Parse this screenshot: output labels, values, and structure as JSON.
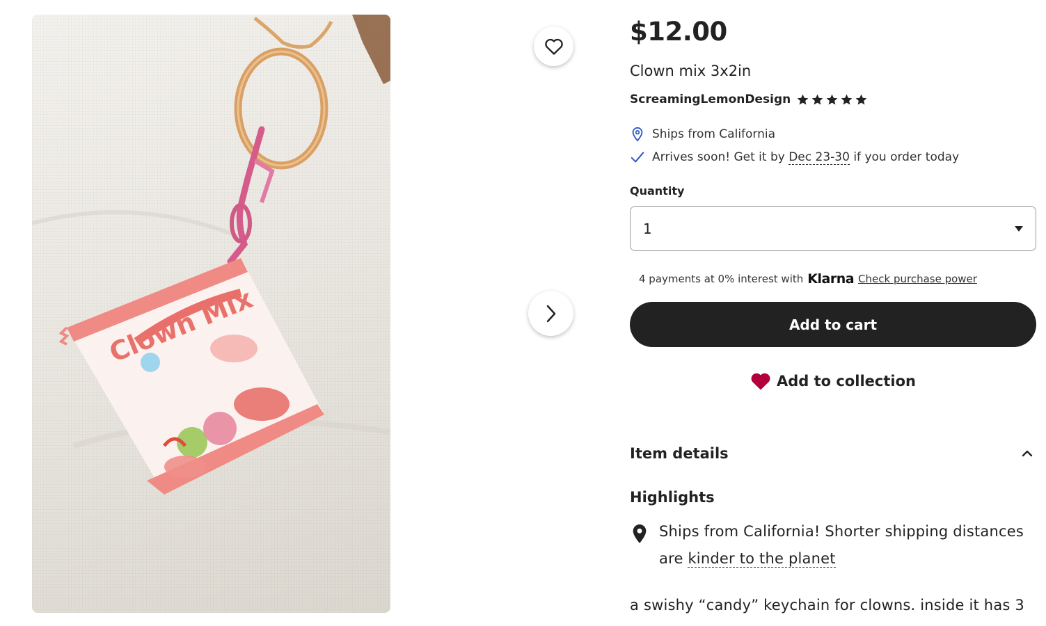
{
  "product": {
    "price": "$12.00",
    "title": "Clown mix 3x2in",
    "seller": "ScreamingLemonDesign",
    "rating_stars": 5,
    "image_text": "Clown Mix"
  },
  "shipping": {
    "ships_from": "Ships from California",
    "arrive_prefix": "Arrives soon! Get it by ",
    "arrive_dates": "Dec 23-30",
    "arrive_suffix": " if you order today"
  },
  "quantity": {
    "label": "Quantity",
    "selected": "1"
  },
  "klarna": {
    "text": "4 payments at 0% interest with",
    "logo": "Klarna",
    "link": "Check purchase power"
  },
  "actions": {
    "add_to_cart": "Add to cart",
    "add_to_collection": "Add to collection"
  },
  "details": {
    "title": "Item details",
    "highlights_title": "Highlights",
    "highlight_text_1": "Ships from California! Shorter shipping distances",
    "highlight_text_2_prefix": "are ",
    "highlight_link": "kinder to the planet",
    "description": "a swishy “candy” keychain for clowns. inside it has 3"
  },
  "colors": {
    "button_dark": "#222222",
    "heart_red": "#b3003c",
    "check_blue": "#2f56c4"
  },
  "icons": [
    "heart-outline-icon",
    "chevron-right-icon",
    "star-icon",
    "location-pin-icon",
    "checkmark-icon",
    "caret-down-icon",
    "heart-filled-icon",
    "chevron-up-icon"
  ]
}
